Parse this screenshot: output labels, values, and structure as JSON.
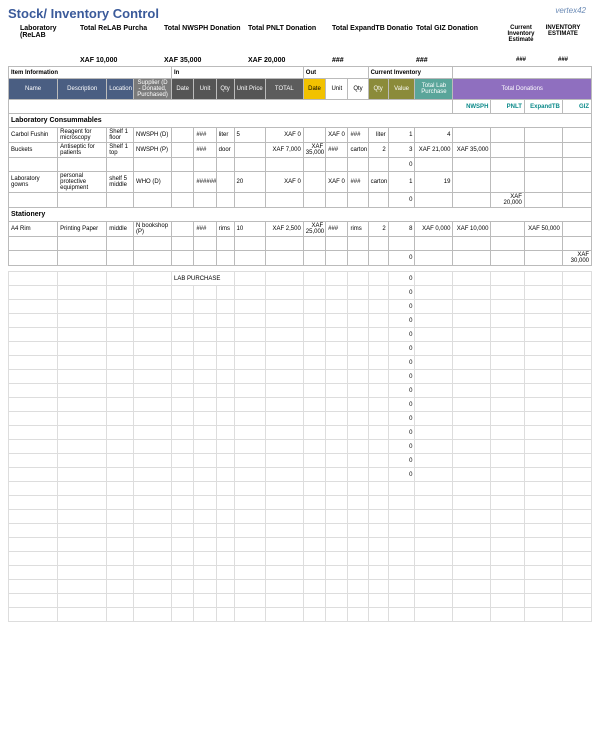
{
  "title": "Stock/ Inventory Control",
  "logo": "vertex42",
  "summary": {
    "lab": "Laboratory (ReLAB",
    "cols": [
      {
        "label": "Total ReLAB Purcha",
        "value": "XAF 10,000"
      },
      {
        "label": "Total NWSPH Donation",
        "value": "XAF 35,000"
      },
      {
        "label": "Total PNLT Donation",
        "value": "XAF 20,000"
      },
      {
        "label": "Total ExpandTB Donatio",
        "value": "###"
      },
      {
        "label": "Total GIZ Donation",
        "value": "###"
      }
    ],
    "current_inv": "Current Inventory Estimate",
    "current_inv_val": "###",
    "inventory": "INVENTORY ESTIMATE",
    "inventory_val": "###"
  },
  "header1": {
    "item_info": "Item Information",
    "in": "In",
    "out": "Out",
    "current": "Current Inventory"
  },
  "header2": {
    "name": "Name",
    "desc": "Description",
    "loc": "Location",
    "supplier": "Supplier (D - Donated, Purchased)",
    "date1": "Date",
    "unit1": "Unit",
    "qty1": "Qty",
    "uprice": "Unit Price",
    "total": "TOTAL",
    "date2": "Date",
    "unit2": "Unit",
    "qty2": "Qty",
    "cqty": "Qty",
    "cval": "Value",
    "tlp": "Total Lab Purchase",
    "tdon": "Total Donations"
  },
  "donation_labels": {
    "nwsph": "NWSPH",
    "pnlt": "PNLT",
    "expandtb": "ExpandTB",
    "giz": "GIZ"
  },
  "cats": {
    "lab": "Laboratory Consummables",
    "stat": "Stationery"
  },
  "rows": [
    {
      "name": "Carbol Fushin",
      "desc": "Reagent for microscopy",
      "loc": "Shelf 1 floor",
      "sup": "NWSPH (D)",
      "date1": "",
      "unit1": "###",
      "qty1": "liter",
      "up": "5",
      "total": "XAF 0",
      "date2": "",
      "unit2": "XAF 0",
      "qty2": "###",
      "cq": "liter",
      "cv": "1",
      "tlp": "4",
      "nwsph": "",
      "pnlt": "",
      "exp": "",
      "giz": ""
    },
    {
      "name": "Buckets",
      "desc": "Antiseptic for patients",
      "loc": "Shelf 1 top",
      "sup": "NWSPH (P)",
      "date1": "",
      "unit1": "###",
      "qty1": "door",
      "up": "",
      "total": "XAF 7,000",
      "date2": "XAF 35,000",
      "unit2": "###",
      "qty2": "carton",
      "cq": "2",
      "cv": "3",
      "tlp": "XAF 21,000",
      "nwsph": "XAF 35,000",
      "pnlt": "",
      "exp": "",
      "giz": ""
    },
    {
      "name": "",
      "desc": "",
      "loc": "",
      "sup": "",
      "date1": "",
      "unit1": "",
      "qty1": "",
      "up": "",
      "total": "",
      "date2": "",
      "unit2": "",
      "qty2": "",
      "cq": "",
      "cv": "0",
      "tlp": "",
      "nwsph": "",
      "pnlt": "",
      "exp": "",
      "giz": ""
    },
    {
      "name": "Laboratory gowns",
      "desc": "personal protective equipment",
      "loc": "shelf 5 middle",
      "sup": "WHO (D)",
      "date1": "",
      "unit1": "######",
      "qty1": "",
      "up": "20",
      "total": "XAF 0",
      "date2": "",
      "unit2": "XAF 0",
      "qty2": "###",
      "cq": "carton",
      "cv": "1",
      "tlp": "19",
      "nwsph": "",
      "pnlt": "",
      "exp": "",
      "giz": ""
    },
    {
      "name": "",
      "desc": "",
      "loc": "",
      "sup": "",
      "date1": "",
      "unit1": "",
      "qty1": "",
      "up": "",
      "total": "",
      "date2": "",
      "unit2": "",
      "qty2": "",
      "cq": "",
      "cv": "0",
      "tlp": "",
      "nwsph": "",
      "pnlt": "XAF 20,000",
      "exp": "",
      "giz": ""
    }
  ],
  "statrows": [
    {
      "name": "A4 Rim",
      "desc": "Printing Paper",
      "loc": "middle",
      "sup": "N bookshop (P)",
      "date1": "",
      "unit1": "###",
      "qty1": "rims",
      "up": "10",
      "total": "XAF 2,500",
      "date2": "XAF 25,000",
      "unit2": "###",
      "qty2": "rims",
      "cq": "2",
      "cv": "8",
      "tlp": "XAF 0,000",
      "nwsph": "XAF 10,000",
      "pnlt": "",
      "exp": "XAF 50,000",
      "giz": ""
    },
    {
      "name": "",
      "desc": "",
      "loc": "",
      "sup": "",
      "date1": "",
      "unit1": "",
      "qty1": "",
      "up": "",
      "total": "",
      "date2": "",
      "unit2": "",
      "qty2": "",
      "cq": "",
      "cv": "",
      "tlp": "",
      "nwsph": "",
      "pnlt": "",
      "exp": "",
      "giz": ""
    },
    {
      "name": "",
      "desc": "",
      "loc": "",
      "sup": "",
      "date1": "",
      "unit1": "",
      "qty1": "",
      "up": "",
      "total": "",
      "date2": "",
      "unit2": "",
      "qty2": "",
      "cq": "",
      "cv": "0",
      "tlp": "",
      "nwsph": "",
      "pnlt": "",
      "exp": "",
      "giz": "XAF 30,000"
    }
  ],
  "lab_purchase_label": "LAB PURCHASE",
  "zero": "0",
  "empty_rows": 24
}
